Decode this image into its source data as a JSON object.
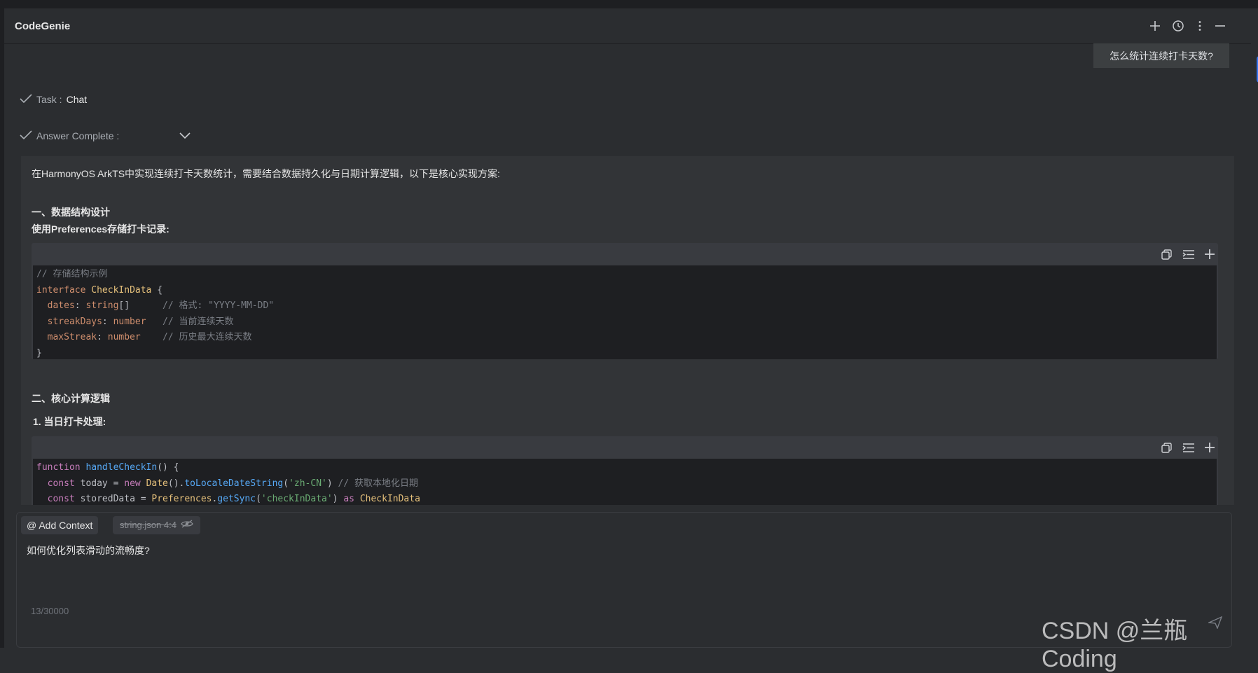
{
  "header": {
    "title": "CodeGenie"
  },
  "conversation": {
    "user_message": "怎么统计连续打卡天数?",
    "task_label": "Task :",
    "task_value": "Chat",
    "answer_status_label": "Answer Complete :",
    "answer": {
      "intro": "在HarmonyOS ArkTS中实现连续打卡天数统计，需要结合数据持久化与日期计算逻辑，以下是核心实现方案:",
      "section1_heading": "一、数据结构设计",
      "section1_desc": "使用Preferences存储打卡记录:",
      "section2_heading": "二、核心计算逻辑",
      "section2_sub": "1. 当日打卡处理:",
      "code1": {
        "l1_comment": "// 存储结构示例",
        "l2_kw": "interface",
        "l2_name": "CheckInData",
        "l2_brace": " {",
        "l3_prop": "  dates",
        "l3_type": "string",
        "l3_rest": "[]",
        "l3_comment": "      // 格式: \"YYYY-MM-DD\"",
        "l4_prop": "  streakDays",
        "l4_type": "number",
        "l4_comment": "   // 当前连续天数",
        "l5_prop": "  maxStreak",
        "l5_type": "number",
        "l5_comment": "    // 历史最大连续天数",
        "l6_brace": "}"
      },
      "code2": {
        "l1_kw": "function",
        "l1_fn": "handleCheckIn",
        "l1_rest": "() {",
        "l2_kw": "  const",
        "l2_var": " today = ",
        "l2_new": "new",
        "l2_cls": "Date",
        "l2_call": "toLocaleDateString",
        "l2_str": "'zh-CN'",
        "l2_comment": "// 获取本地化日期",
        "l3_kw": "  const",
        "l3_var": " storedData = ",
        "l3_cls": "Preferences",
        "l3_call": "getSync",
        "l3_str": "'checkInData'",
        "l3_as": "as",
        "l3_type": "CheckInData"
      }
    }
  },
  "input": {
    "add_context_label": "@ Add Context",
    "file_chip": "string.json 4:4",
    "text": "如何优化列表滑动的流畅度?",
    "counter": "13/30000"
  },
  "watermark": "CSDN @兰瓶Coding",
  "icons": {
    "header": [
      "plus-icon",
      "history-icon",
      "more-vertical-icon",
      "minimize-icon"
    ],
    "code_toolbar": [
      "copy-icon",
      "insert-icon",
      "add-icon"
    ],
    "status": "check-icon",
    "expand": "chevron-down-icon",
    "file_chip": "eye-off-icon",
    "send": "send-icon"
  },
  "colors": {
    "panel_bg": "#2b2d30",
    "code_bg": "#1e1f22",
    "keyword": "#cf8e6d",
    "type": "#e5c07b",
    "function": "#56a8f5",
    "string": "#6aab73",
    "comment": "#7a7e85",
    "accent": "#3574f0"
  }
}
